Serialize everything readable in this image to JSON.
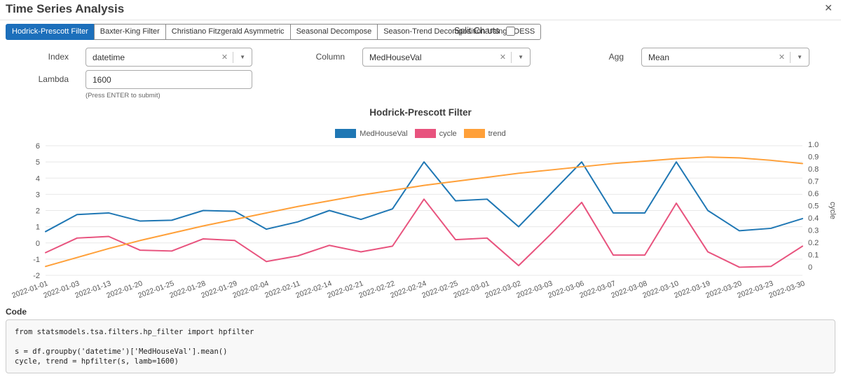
{
  "header": {
    "title": "Time Series Analysis"
  },
  "icons": {
    "close": "✕",
    "clear": "✕",
    "dropdown": "▼"
  },
  "colors": {
    "accent": "#1c6fbb"
  },
  "tabs": [
    {
      "label": "Hodrick-Prescott Filter",
      "active": true
    },
    {
      "label": "Baxter-King Filter",
      "active": false
    },
    {
      "label": "Christiano Fitzgerald Asymmetric",
      "active": false
    },
    {
      "label": "Seasonal Decompose",
      "active": false
    },
    {
      "label": "Season-Trend Decomposition Using LOESS",
      "active": false
    }
  ],
  "split_charts": {
    "label": "Split Charts",
    "checked": false
  },
  "form": {
    "index": {
      "label": "Index",
      "value": "datetime"
    },
    "column": {
      "label": "Column",
      "value": "MedHouseVal"
    },
    "agg": {
      "label": "Agg",
      "value": "Mean"
    },
    "lambda": {
      "label": "Lambda",
      "value": "1600",
      "hint": "(Press ENTER to submit)"
    }
  },
  "chart_data": {
    "type": "line",
    "title": "Hodrick-Prescott Filter",
    "grid": true,
    "legend_position": "top",
    "x": [
      "2022-01-01",
      "2022-01-03",
      "2022-01-13",
      "2022-01-20",
      "2022-01-25",
      "2022-01-28",
      "2022-01-29",
      "2022-02-04",
      "2022-02-11",
      "2022-02-14",
      "2022-02-21",
      "2022-02-22",
      "2022-02-24",
      "2022-02-25",
      "2022-03-01",
      "2022-03-02",
      "2022-03-03",
      "2022-03-06",
      "2022-03-07",
      "2022-03-08",
      "2022-03-10",
      "2022-03-19",
      "2022-03-20",
      "2022-03-23",
      "2022-03-30"
    ],
    "series": [
      {
        "name": "MedHouseVal",
        "color": "#1f77b4",
        "axis": "left",
        "values": [
          0.7,
          1.75,
          1.85,
          1.35,
          1.4,
          2.0,
          1.95,
          0.85,
          1.3,
          2.0,
          1.45,
          2.1,
          5.0,
          2.6,
          2.7,
          1.0,
          3.0,
          5.0,
          1.85,
          1.85,
          5.0,
          2.0,
          0.75,
          0.9,
          1.5
        ]
      },
      {
        "name": "cycle",
        "color": "#e8537e",
        "axis": "left",
        "values": [
          -0.6,
          0.3,
          0.4,
          -0.45,
          -0.5,
          0.25,
          0.15,
          -1.15,
          -0.8,
          -0.15,
          -0.55,
          -0.2,
          2.7,
          0.2,
          0.3,
          -1.4,
          0.5,
          2.5,
          -0.75,
          -0.75,
          2.45,
          -0.55,
          -1.5,
          -1.45,
          -0.2
        ]
      },
      {
        "name": "trend",
        "color": "#ffa039",
        "axis": "left",
        "values": [
          -1.45,
          -0.9,
          -0.35,
          0.15,
          0.6,
          1.05,
          1.45,
          1.85,
          2.25,
          2.6,
          2.95,
          3.25,
          3.55,
          3.8,
          4.05,
          4.3,
          4.5,
          4.7,
          4.9,
          5.05,
          5.2,
          5.3,
          5.25,
          5.1,
          4.9
        ]
      }
    ],
    "left_axis": {
      "min": -2,
      "max": 6,
      "ticks": [
        6,
        5,
        4,
        3,
        2,
        1,
        0,
        -1,
        -2
      ]
    },
    "right_axis": {
      "label": "cycle",
      "min": 0,
      "max": 1,
      "ticks": [
        "1.0",
        "0.9",
        "0.8",
        "0.7",
        "0.6",
        "0.5",
        "0.4",
        "0.3",
        "0.2",
        "0.1",
        "0"
      ]
    }
  },
  "code_section": {
    "label": "Code",
    "lines": [
      "from statsmodels.tsa.filters.hp_filter import hpfilter",
      "",
      "s = df.groupby('datetime')['MedHouseVal'].mean()",
      "cycle, trend = hpfilter(s, lamb=1600)"
    ]
  }
}
